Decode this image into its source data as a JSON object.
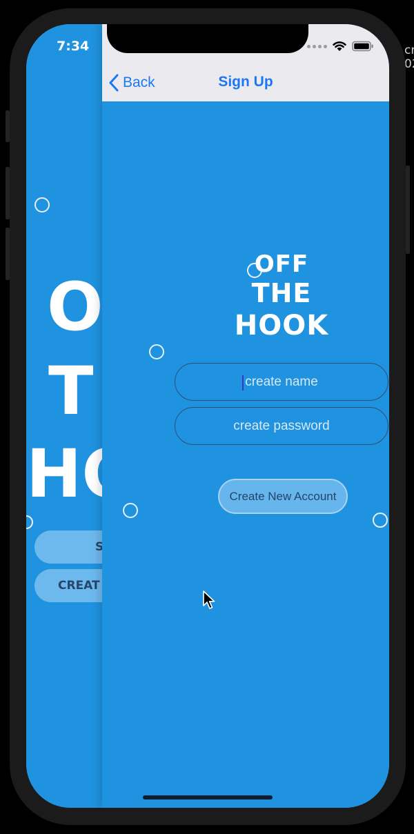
{
  "status_bar": {
    "time": "7:34"
  },
  "navbar": {
    "back_label": "Back",
    "title": "Sign Up"
  },
  "background_screen": {
    "logo_lines": [
      "O",
      "T",
      "HO"
    ],
    "button_fragments": [
      "S",
      "CREAT"
    ]
  },
  "logo": {
    "lines": [
      "OFF",
      "THE",
      "HOOK"
    ]
  },
  "form": {
    "name_placeholder": "create name",
    "password_placeholder": "create password",
    "submit_label": "Create New Account"
  },
  "edge_text": [
    "cr",
    "02"
  ],
  "colors": {
    "background": "#1f93e0",
    "navbar": "#ebeaef",
    "accent": "#1b78f2",
    "button_fill": "#66b5ec",
    "button_text": "#21456a"
  },
  "icons": {
    "back": "chevron-left-icon",
    "signal": "signal-dots-icon",
    "wifi": "wifi-icon",
    "battery": "battery-icon",
    "cursor": "mouse-cursor-icon"
  }
}
